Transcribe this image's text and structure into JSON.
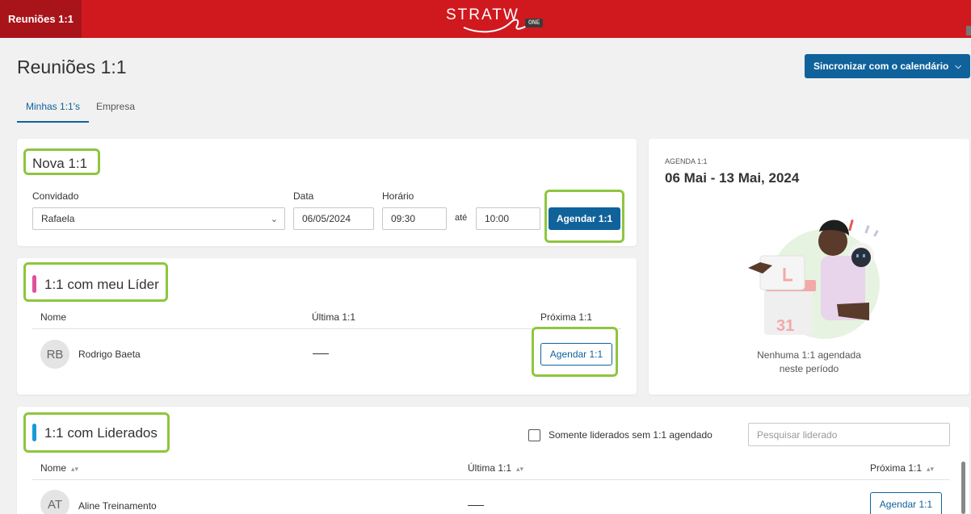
{
  "topbar": {
    "active_tab": "Reuniões 1:1",
    "logo_text": "STRATW",
    "logo_badge": "ONE",
    "color": "#d0191f"
  },
  "header": {
    "title": "Reuniões 1:1",
    "sync_button": "Sincronizar com o calendário",
    "tabs": [
      {
        "label": "Minhas 1:1's",
        "active": true
      },
      {
        "label": "Empresa",
        "active": false
      }
    ]
  },
  "nova": {
    "title": "Nova 1:1",
    "convidado_label": "Convidado",
    "convidado_value": "Rafaela",
    "data_label": "Data",
    "data_value": "06/05/2024",
    "horario_label": "Horário",
    "hora_inicio": "09:30",
    "ate_label": "até",
    "hora_fim": "10:00",
    "agendar_button": "Agendar 1:1"
  },
  "lider": {
    "title": "1:1 com meu Líder",
    "accent": "#e0539a",
    "columns": [
      "Nome",
      "Última 1:1",
      "Próxima 1:1"
    ],
    "rows": [
      {
        "initials": "RB",
        "name": "Rodrigo Baeta",
        "ultima": "—",
        "action": "Agendar 1:1"
      }
    ]
  },
  "agenda": {
    "small_label": "AGENDA 1:1",
    "range": "06 Mai - 13 Mai, 2024",
    "empty_line1": "Nenhuma 1:1 agendada",
    "empty_line2": "neste período",
    "calendar_number": "31"
  },
  "liderados": {
    "title": "1:1 com Liderados",
    "accent": "#1a9ad6",
    "filter_label": "Somente liderados sem 1:1 agendado",
    "filter_checked": false,
    "search_placeholder": "Pesquisar liderado",
    "columns": [
      "Nome",
      "Última 1:1",
      "Próxima 1:1"
    ],
    "rows": [
      {
        "initials": "AT",
        "name": "Aline Treinamento",
        "ultima": "—",
        "action": "Agendar 1:1"
      }
    ]
  }
}
